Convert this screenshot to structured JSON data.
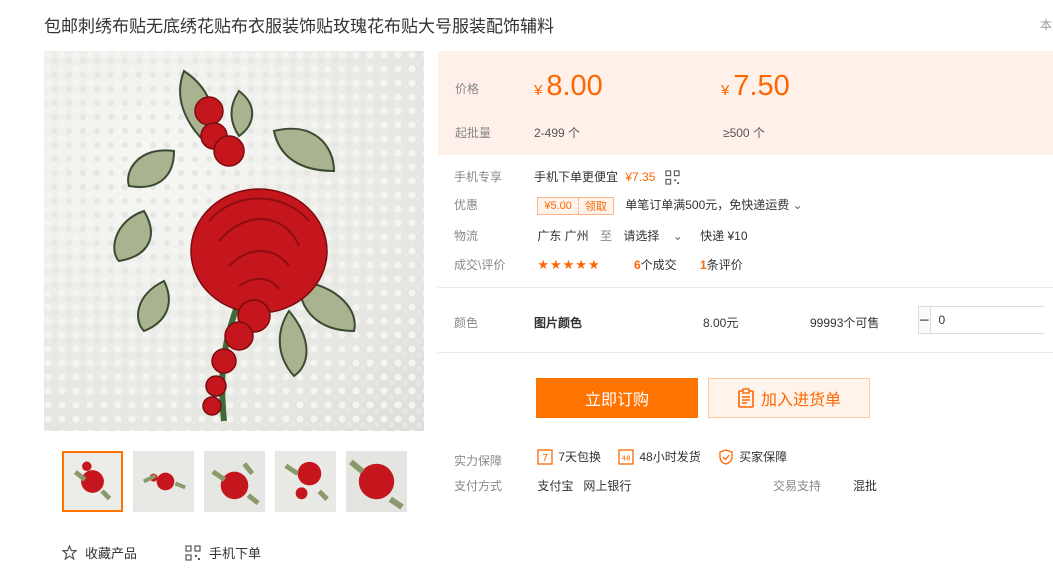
{
  "product": {
    "title": "包邮刺绣布贴无底绣花贴布衣服装饰贴玫瑰花布贴大号服装配饰辅料",
    "top_right_char": "本"
  },
  "price": {
    "label": "价格",
    "currency": "¥",
    "price_1": "8.00",
    "price_2": "7.50",
    "moq_label": "起批量",
    "range_1": "2-499 个",
    "range_2": "≥500 个"
  },
  "mobile": {
    "label": "手机专享",
    "text": "手机下单更便宜",
    "price": "¥7.35"
  },
  "coupon": {
    "label": "优惠",
    "amount": "¥5.00",
    "claim": "领取",
    "desc": "单笔订单满500元，免快递运费"
  },
  "logistics": {
    "label": "物流",
    "origin": "广东 广州",
    "to": "至",
    "dest": "请选择",
    "express": "快递 ¥10"
  },
  "deals": {
    "label": "成交\\评价",
    "stars": "★★★★★",
    "deal_count": "6",
    "deal_text": "个成交",
    "review_count": "1",
    "review_text": "条评价"
  },
  "variant": {
    "label": "颜色",
    "name": "图片颜色",
    "price": "8.00元",
    "stock": "99993个可售",
    "quantity": "0"
  },
  "actions": {
    "buy": "立即订购",
    "cart": "加入进货单"
  },
  "guarantee": {
    "label": "实力保障",
    "items": [
      "7天包换",
      "48小时发货",
      "买家保障"
    ]
  },
  "payment": {
    "label": "支付方式",
    "methods": "支付宝   网上银行",
    "trade_label": "交易支持",
    "trade_value": "混批"
  },
  "bottom": {
    "favorite": "收藏产品",
    "mobile_order": "手机下单"
  },
  "colors": {
    "accent": "#ff7300",
    "price_bg": "#fff1e9"
  }
}
